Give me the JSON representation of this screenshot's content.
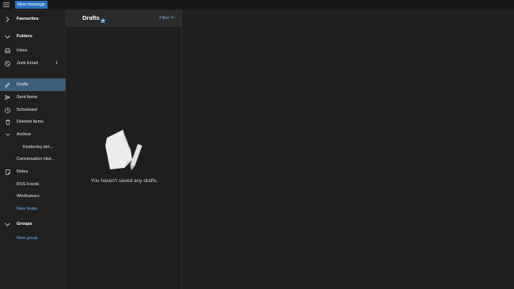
{
  "toolbar": {
    "new_message_label": "New message"
  },
  "sidebar": {
    "favourites_label": "Favourites",
    "folders_label": "Folders",
    "folders": [
      {
        "label": "Inbox",
        "icon": "inbox-icon"
      },
      {
        "label": "Junk Email",
        "icon": "junk-icon",
        "count": "1"
      },
      {
        "label": "Drafts",
        "icon": "pencil-icon",
        "selected": true
      },
      {
        "label": "Sent Items",
        "icon": "send-icon"
      },
      {
        "label": "Scheduled",
        "icon": "clock-icon"
      },
      {
        "label": "Deleted Items",
        "icon": "trash-icon"
      },
      {
        "label": "Archive",
        "icon": "chevron-down-icon"
      },
      {
        "label": "Kimberley birt...",
        "indent": true
      },
      {
        "label": "Conversation Hist..."
      },
      {
        "label": "Notes",
        "icon": "note-icon"
      },
      {
        "label": "RSS Feeds"
      },
      {
        "label": "WinRumors"
      }
    ],
    "new_folder_label": "New folder",
    "groups_label": "Groups",
    "new_group_label": "New group"
  },
  "list": {
    "title": "Drafts",
    "filter_label": "Filter",
    "empty_message": "You haven't saved any drafts."
  },
  "colors": {
    "accent": "#2b74c4",
    "selection": "#3d5d79",
    "link": "#6eb6f5"
  }
}
